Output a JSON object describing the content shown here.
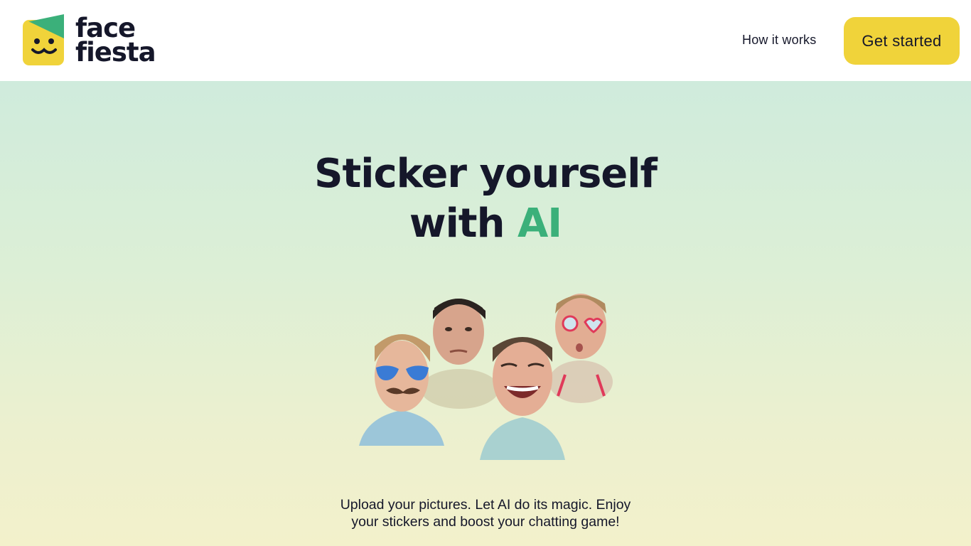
{
  "brand": {
    "name_line1": "face",
    "name_line2": "fiesta",
    "colors": {
      "yellow": "#f0d33a",
      "green": "#3bb07a",
      "dark": "#15172a"
    }
  },
  "nav": {
    "how_it_works": "How it works",
    "get_started": "Get started"
  },
  "hero": {
    "headline_part1": "Sticker yourself",
    "headline_part2": "with ",
    "headline_accent": "AI",
    "tagline_line1": "Upload your pictures. Let AI do its magic. Enjoy",
    "tagline_line2": "your stickers and boost your chatting game!"
  },
  "stickers": [
    {
      "label": "sticker-sunglasses-mustache"
    },
    {
      "label": "sticker-serious-face"
    },
    {
      "label": "sticker-laughing-face"
    },
    {
      "label": "sticker-heart-glasses"
    }
  ]
}
